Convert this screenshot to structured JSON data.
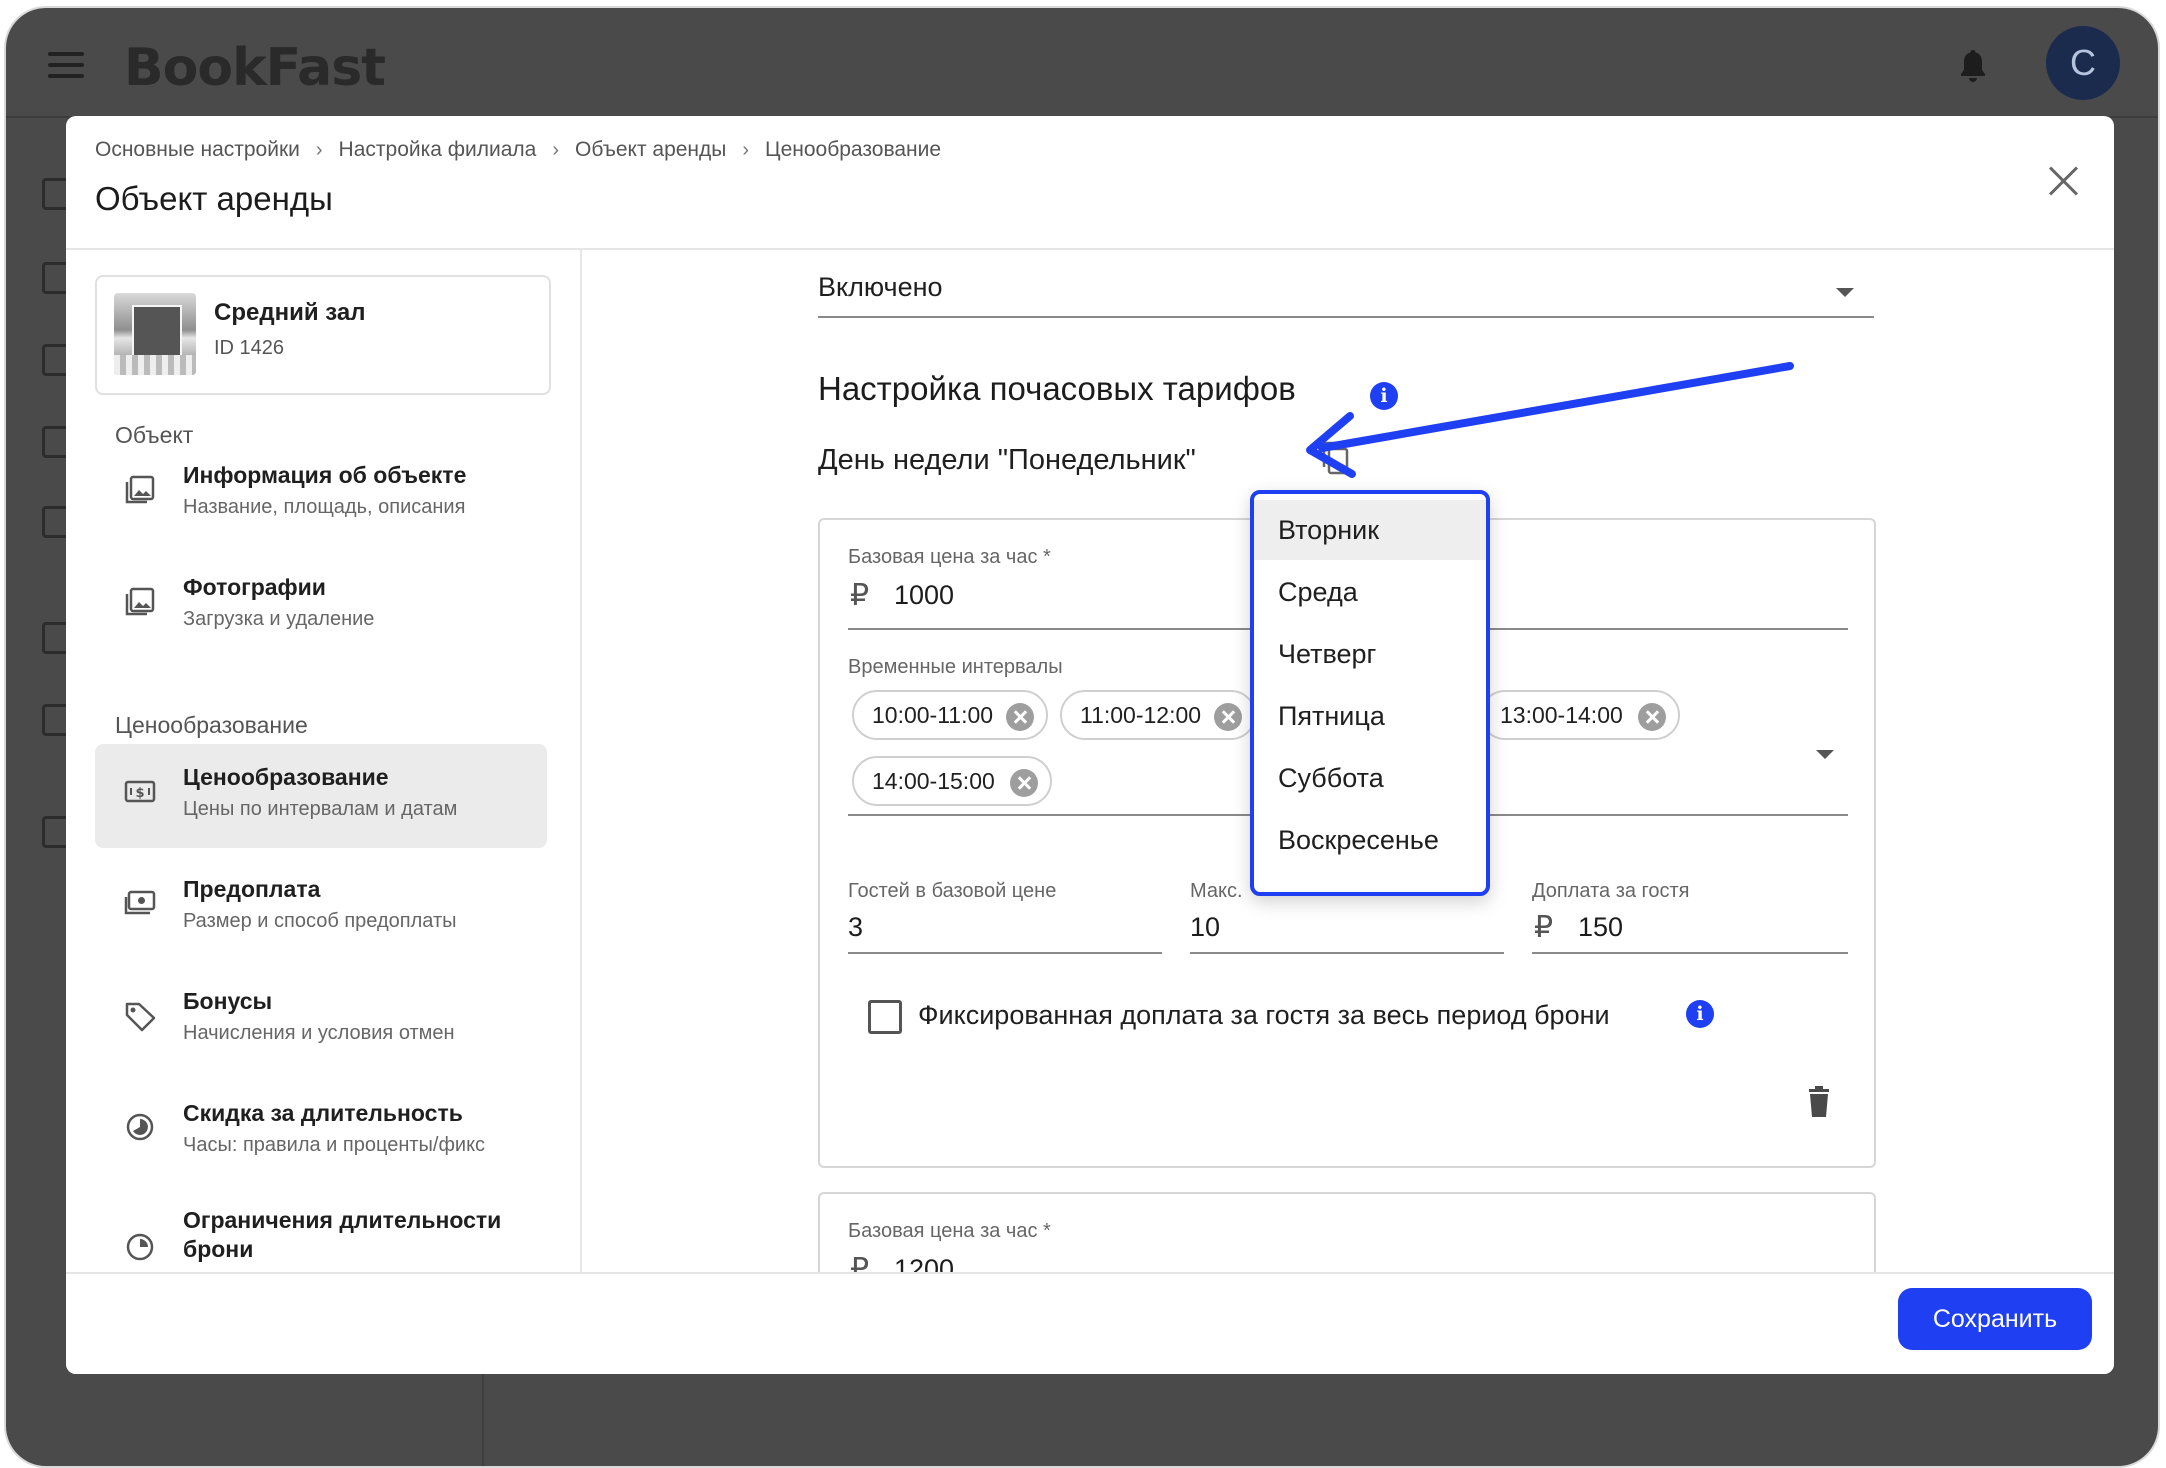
{
  "app": {
    "logo": "BookFast",
    "avatar_letter": "C"
  },
  "breadcrumb": [
    "Основные настройки",
    "Настройка филиала",
    "Объект аренды",
    "Ценообразование"
  ],
  "page_title": "Объект аренды",
  "object_card": {
    "name": "Средний зал",
    "id": "ID 1426"
  },
  "nav": {
    "section_object": "Объект",
    "section_pricing": "Ценообразование",
    "items": [
      {
        "title": "Информация об объекте",
        "subtitle": "Название, площадь, описания",
        "icon": "image-icon"
      },
      {
        "title": "Фотографии",
        "subtitle": "Загрузка и удаление",
        "icon": "image-icon"
      },
      {
        "title": "Ценообразование",
        "subtitle": "Цены по интервалам и датам",
        "icon": "price-tag-icon",
        "active": true
      },
      {
        "title": "Предоплата",
        "subtitle": "Размер и способ предоплаты",
        "icon": "money-icon"
      },
      {
        "title": "Бонусы",
        "subtitle": "Начисления и условия отмен",
        "icon": "tag-icon"
      },
      {
        "title": "Скидка за длительность",
        "subtitle": "Часы: правила и проценты/фикс",
        "icon": "clock-icon"
      },
      {
        "title": "Ограничения длительности брони",
        "subtitle": "",
        "icon": "clock-icon"
      }
    ]
  },
  "main": {
    "status_select": "Включено",
    "section_title": "Настройка почасовых тарифов",
    "day_label": "День недели \"Понедельник\"",
    "card": {
      "base_price_label": "Базовая цена за час *",
      "currency": "₽",
      "base_price": "1000",
      "intervals_label": "Временные интервалы",
      "chips": [
        "10:00-11:00",
        "11:00-12:00",
        "13:00-14:00",
        "14:00-15:00"
      ],
      "guests_label": "Гостей в базовой цене",
      "guests_value": "3",
      "max_label": "Макс.",
      "max_value": "10",
      "surcharge_label": "Доплата за гостя",
      "surcharge_value": "150",
      "fixed_checkbox_label": "Фиксированная доплата за гостя за весь период брони",
      "fixed_checked": false
    },
    "card2": {
      "base_price_label": "Базовая цена за час *",
      "base_price_partial": "1200"
    }
  },
  "dropdown": {
    "items": [
      "Вторник",
      "Среда",
      "Четверг",
      "Пятница",
      "Суббота",
      "Воскресенье"
    ],
    "highlighted_index": 0
  },
  "footer": {
    "save_label": "Сохранить"
  },
  "colors": {
    "accent": "#1f3ff2",
    "overlay": "#4a4a4b"
  }
}
